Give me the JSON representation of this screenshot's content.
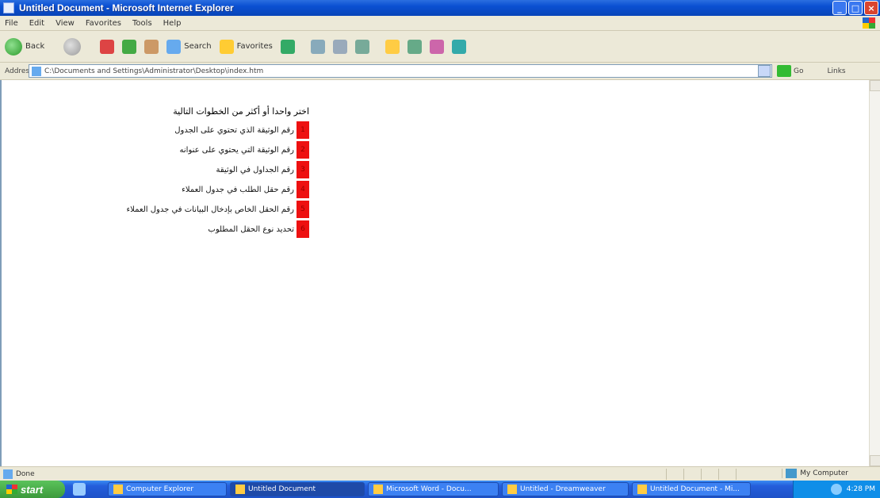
{
  "window": {
    "title": "Untitled Document - Microsoft Internet Explorer"
  },
  "menu": [
    "File",
    "Edit",
    "View",
    "Favorites",
    "Tools",
    "Help"
  ],
  "toolbar": {
    "back": "Back",
    "search": "Search",
    "favorites": "Favorites"
  },
  "address": {
    "label": "Address",
    "url": "C:\\Documents and Settings\\Administrator\\Desktop\\index.htm",
    "go": "Go",
    "links": "Links"
  },
  "content": {
    "heading": "اختر واحدا أو أكثر من الخطوات التالية",
    "items": [
      {
        "marker": "1",
        "label": "رقم الوثيقة الذي تحتوي على الجدول"
      },
      {
        "marker": "2",
        "label": "رقم الوثيقة التي يحتوي على عنوانه"
      },
      {
        "marker": "3",
        "label": "رقم الجداول في الوثيقة"
      },
      {
        "marker": "4",
        "label": "رقم حقل الطلب في جدول العملاء"
      },
      {
        "marker": "5",
        "label": "رقم الحقل الخاص بإدخال البيانات في جدول العملاء"
      },
      {
        "marker": "6",
        "label": "تحديد نوع الحقل المطلوب"
      }
    ]
  },
  "status": {
    "text": "Done",
    "zone": "My Computer"
  },
  "taskbar": {
    "start": "start",
    "tasks": [
      {
        "label": "Computer Explorer",
        "active": false
      },
      {
        "label": "Untitled Document",
        "active": true
      },
      {
        "label": "Microsoft Word - Docu...",
        "active": false
      },
      {
        "label": "Untitled - Dreamweaver",
        "active": false
      },
      {
        "label": "Untitled Document - Mi...",
        "active": false
      }
    ],
    "time": "4:28 PM"
  }
}
